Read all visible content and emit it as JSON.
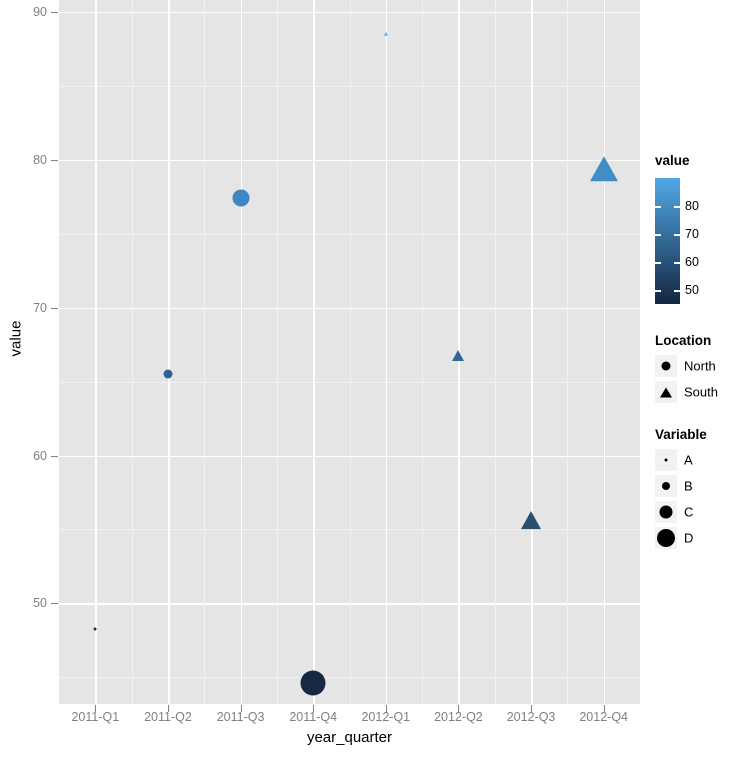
{
  "chart_data": {
    "type": "scatter",
    "title": "",
    "xlabel": "year_quarter",
    "ylabel": "value",
    "categories": [
      "2011-Q1",
      "2011-Q2",
      "2011-Q3",
      "2011-Q4",
      "2012-Q1",
      "2012-Q2",
      "2012-Q3",
      "2012-Q4"
    ],
    "ylim": [
      43.2,
      90.8
    ],
    "y_ticks": [
      50,
      60,
      70,
      80,
      90
    ],
    "y_tick_labels": [
      "50",
      "60",
      "70",
      "80",
      "90"
    ],
    "grid": true,
    "legend_position": "right",
    "points": [
      {
        "x": "2011-Q1",
        "y": 48.3,
        "location": "North",
        "variable": "A",
        "shape": "circle",
        "size": 3.0,
        "color": "#1c2f4a"
      },
      {
        "x": "2011-Q2",
        "y": 65.5,
        "location": "North",
        "variable": "B",
        "shape": "circle",
        "size": 9.0,
        "color": "#2f6193"
      },
      {
        "x": "2011-Q3",
        "y": 77.4,
        "location": "North",
        "variable": "C",
        "shape": "circle",
        "size": 17.0,
        "color": "#3c87c4"
      },
      {
        "x": "2011-Q4",
        "y": 44.6,
        "location": "North",
        "variable": "D",
        "shape": "circle",
        "size": 25.0,
        "color": "#172940"
      },
      {
        "x": "2012-Q1",
        "y": 88.5,
        "location": "South",
        "variable": "A",
        "shape": "triangle",
        "size": 5.0,
        "color": "#62b4ea"
      },
      {
        "x": "2012-Q2",
        "y": 66.7,
        "location": "South",
        "variable": "B",
        "shape": "triangle",
        "size": 12.0,
        "color": "#33679b"
      },
      {
        "x": "2012-Q3",
        "y": 55.6,
        "location": "South",
        "variable": "C",
        "shape": "triangle",
        "size": 20.0,
        "color": "#27506f"
      },
      {
        "x": "2012-Q4",
        "y": 79.3,
        "location": "South",
        "variable": "D",
        "shape": "triangle",
        "size": 28.0,
        "color": "#418ec7"
      }
    ]
  },
  "legends": {
    "colorbar": {
      "title": "value",
      "ticks": [
        80,
        70,
        60,
        50
      ],
      "tick_labels": [
        "80",
        "70",
        "60",
        "50"
      ],
      "range": [
        45.0,
        90.0
      ],
      "color_low": "#132740",
      "color_high": "#52a8e8"
    },
    "shape_legend": {
      "title": "Location",
      "items": [
        {
          "label": "North",
          "glyph": "circle-marker",
          "shape": "circle"
        },
        {
          "label": "South",
          "glyph": "triangle-marker",
          "shape": "triangle"
        }
      ]
    },
    "size_legend": {
      "title": "Variable",
      "items": [
        {
          "label": "A",
          "glyph": "circle-marker",
          "size": 3.0
        },
        {
          "label": "B",
          "glyph": "circle-marker",
          "size": 8.0
        },
        {
          "label": "C",
          "glyph": "circle-marker",
          "size": 13.0
        },
        {
          "label": "D",
          "glyph": "circle-marker",
          "size": 18.0
        }
      ]
    }
  },
  "theme": {
    "panel_background": "#e5e5e5",
    "grid_major": "#ffffff",
    "grid_minor": "#f2f2f2",
    "axis_text": "#808080",
    "title_text": "#000000"
  }
}
